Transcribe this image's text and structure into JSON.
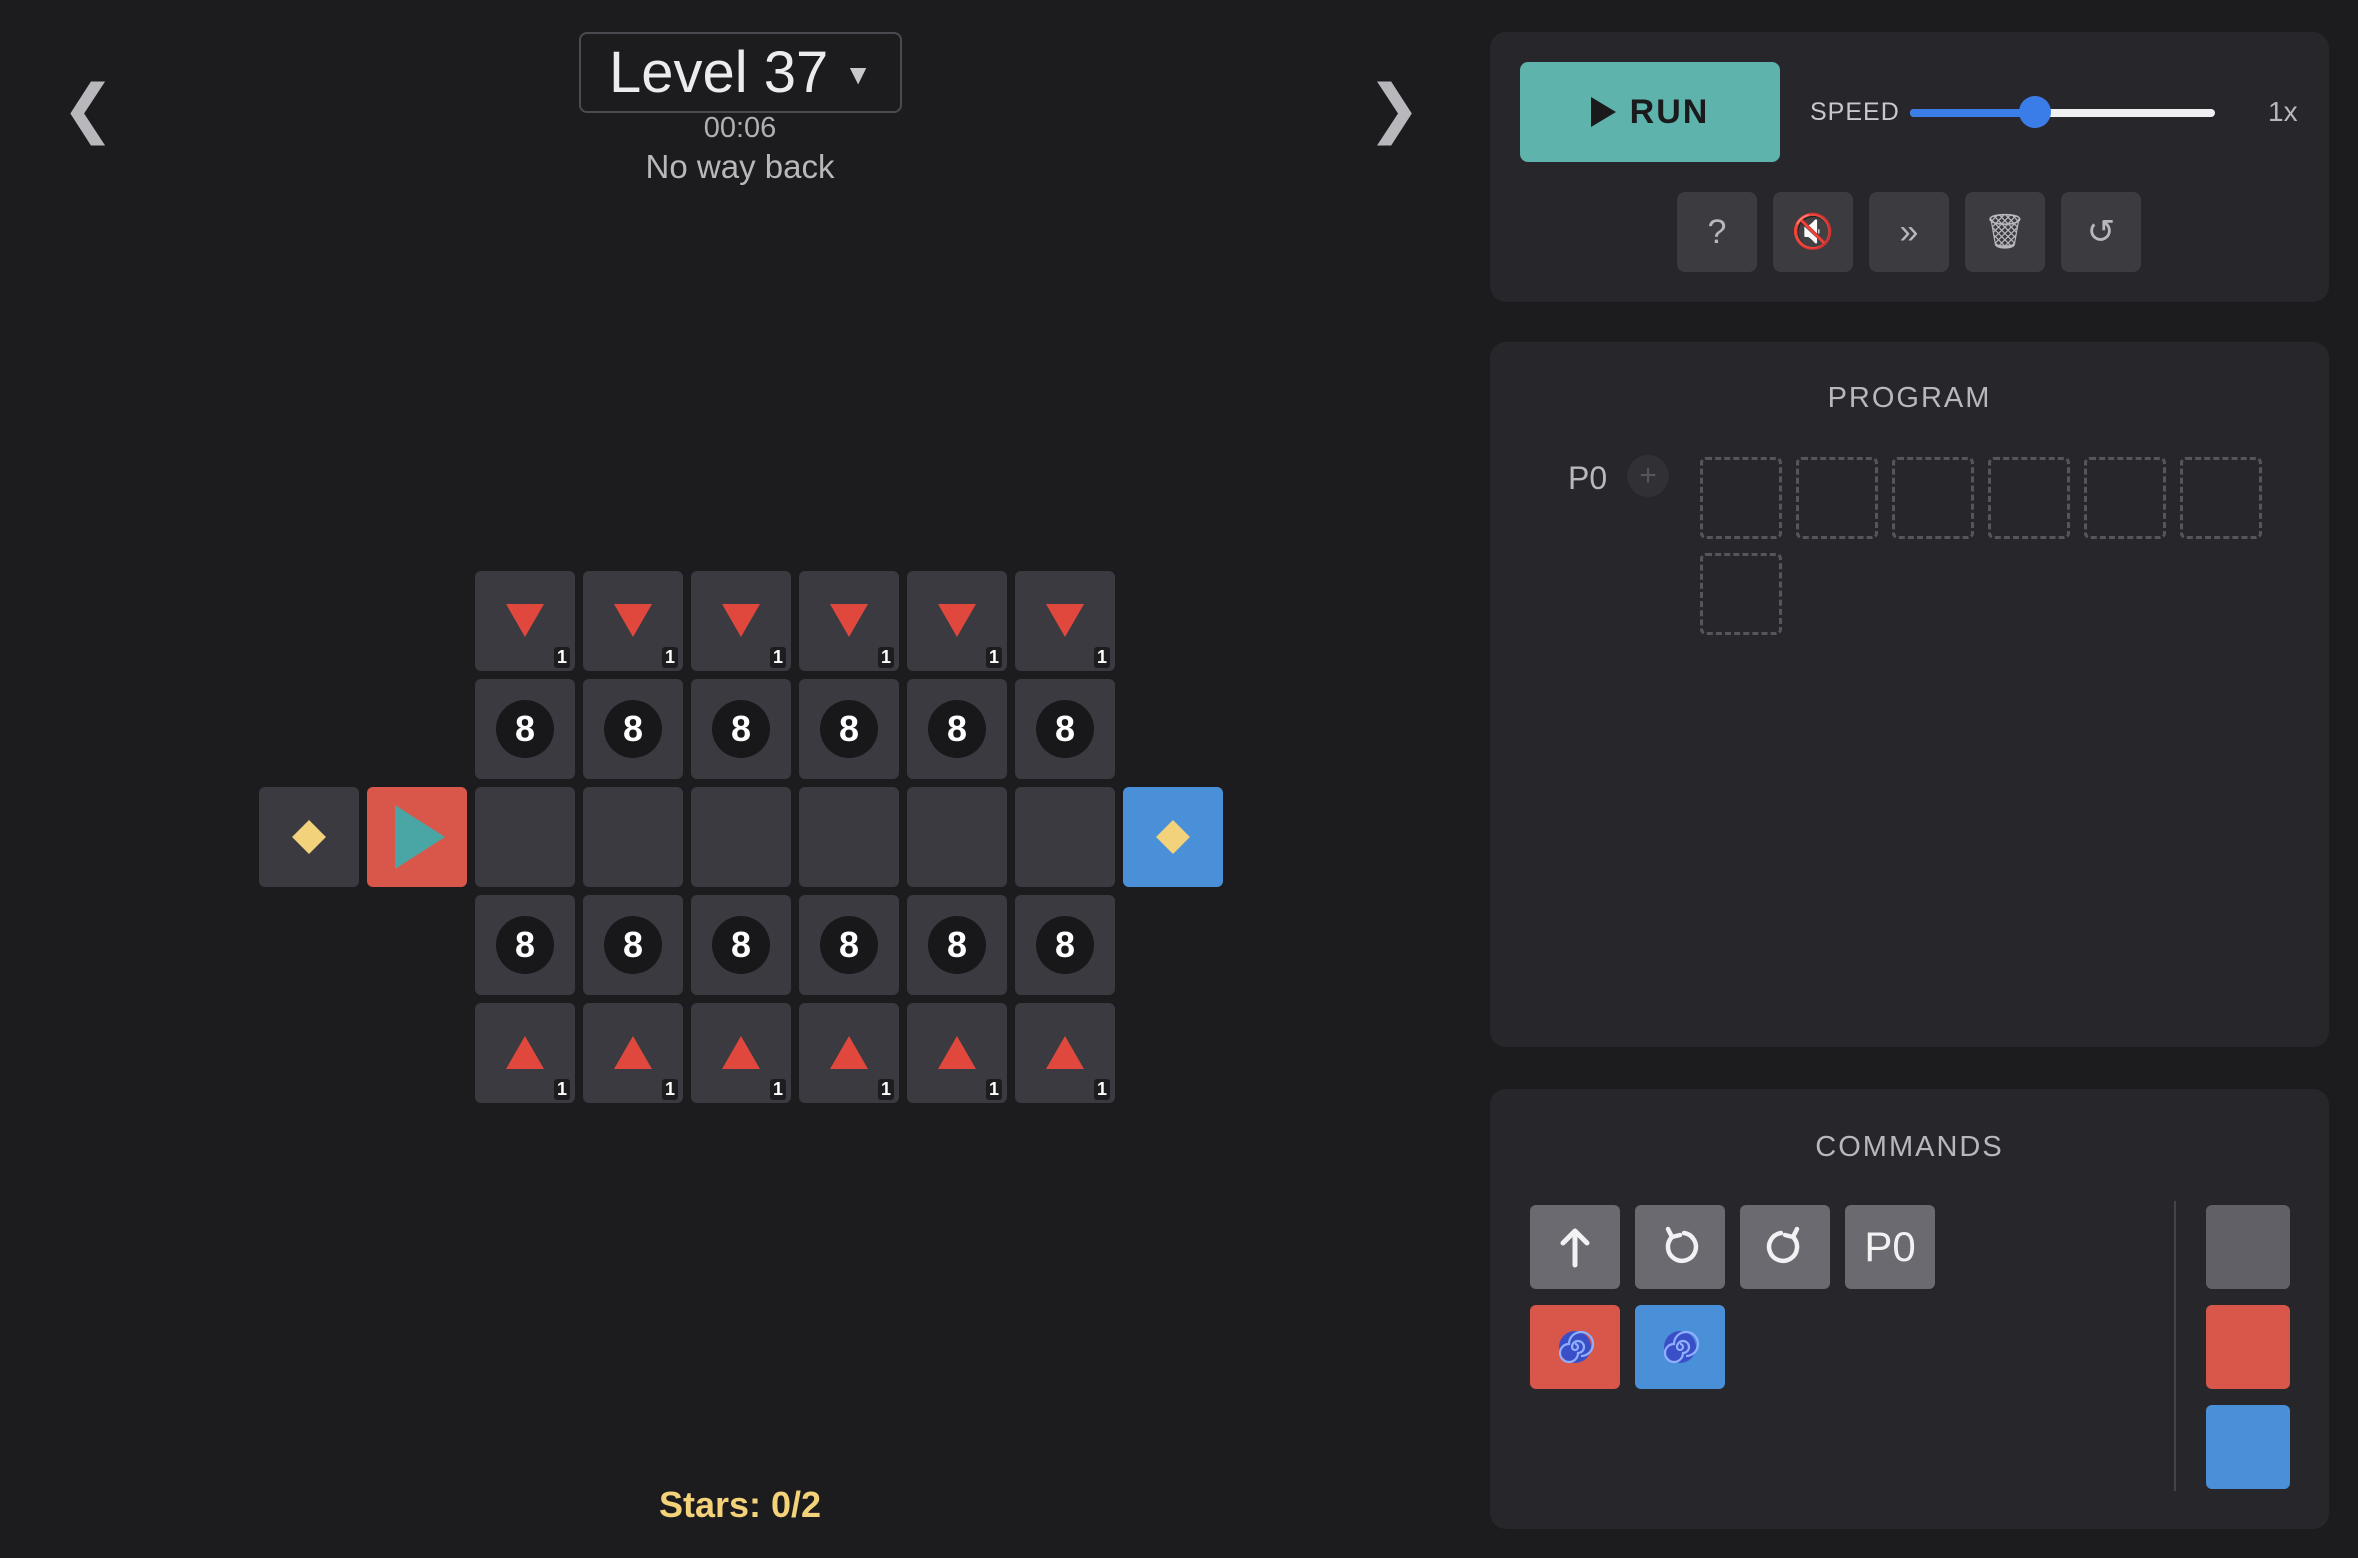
{
  "header": {
    "prev_arrow": "❮",
    "next_arrow": "❯",
    "level_label": "Level 37",
    "level_caret": "▼",
    "timer": "00:06",
    "subtitle": "No way back"
  },
  "footer": {
    "stars": "Stars: 0/2"
  },
  "board": {
    "top_triangle_count": "1",
    "bottom_triangle_count": "1",
    "ball_label": "8",
    "colors": {
      "tile": "#3a3a40",
      "red": "#d9564a",
      "blue": "#4a90d9",
      "triangle": "#e0483d",
      "star": "#f2d27a",
      "player": "#4aa6a4"
    }
  },
  "controls": {
    "run_label": "RUN",
    "speed_label": "SPEED",
    "speed_value": "1x",
    "speed_fraction": 0.41,
    "tools": [
      {
        "icon": "help-icon",
        "glyph": "?"
      },
      {
        "icon": "mute-icon",
        "glyph": "🔇"
      },
      {
        "icon": "fast-forward-icon",
        "glyph": "»"
      },
      {
        "icon": "trash-icon",
        "glyph": "🗑"
      },
      {
        "icon": "reset-icon",
        "glyph": "↺"
      }
    ]
  },
  "program": {
    "title": "PROGRAM",
    "function_label": "P0",
    "add_glyph": "+",
    "slot_count": 7
  },
  "commands": {
    "title": "COMMANDS",
    "function_button": "P0",
    "buttons": [
      "forward-arrow-icon",
      "turn-left-icon",
      "turn-right-icon",
      "function-p0",
      "spiral-red-icon",
      "spiral-blue-icon"
    ],
    "colors": [
      "#606066",
      "#d9564a",
      "#4a90d9"
    ]
  }
}
